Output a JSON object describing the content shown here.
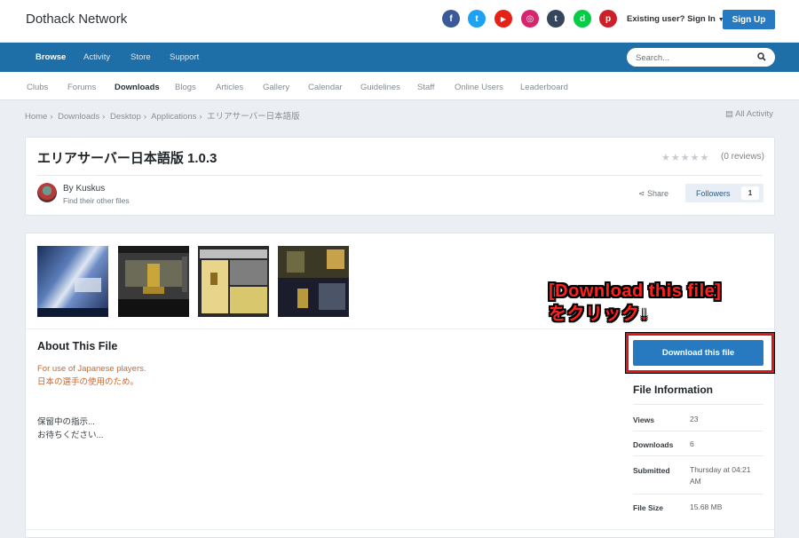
{
  "header": {
    "site_title": "Dothack Network",
    "signin": "Existing user? Sign In",
    "signup": "Sign Up",
    "social": [
      {
        "name": "facebook",
        "color": "#3b5998",
        "glyph": "f"
      },
      {
        "name": "twitter",
        "color": "#1da1f2",
        "glyph": "t"
      },
      {
        "name": "youtube",
        "color": "#e62117",
        "glyph": "▶"
      },
      {
        "name": "instagram",
        "color": "#d6246e",
        "glyph": "◎"
      },
      {
        "name": "tumblr",
        "color": "#35465c",
        "glyph": "t"
      },
      {
        "name": "deviantart",
        "color": "#05cc47",
        "glyph": "d"
      },
      {
        "name": "pinterest",
        "color": "#cb2027",
        "glyph": "p"
      }
    ]
  },
  "nav": {
    "items": [
      "Browse",
      "Activity",
      "Store",
      "Support"
    ],
    "search_placeholder": "Search..."
  },
  "subnav": {
    "items": [
      "Clubs",
      "Forums",
      "Downloads",
      "Blogs",
      "Articles",
      "Gallery",
      "Calendar",
      "Guidelines",
      "Staff",
      "Online Users",
      "Leaderboard"
    ]
  },
  "breadcrumb": {
    "items": [
      "Home",
      "Downloads",
      "Desktop",
      "Applications",
      "エリアサーバー日本語版"
    ],
    "all_activity": "All Activity"
  },
  "file": {
    "title": "エリアサーバー日本語版 1.0.3",
    "reviews": "(0 reviews)",
    "author": "By Kuskus",
    "author_link": "Find their other files",
    "share": "Share",
    "followers_label": "Followers",
    "followers_count": "1"
  },
  "about": {
    "heading": "About This File",
    "desc_en": "For use of Japanese players.",
    "desc_jp": "日本の選手の使用のため。",
    "pending_1": "保留中の指示...",
    "pending_2": "お待ちください..."
  },
  "annotation": {
    "line1": "[Download this file]",
    "line2": "をクリック↓"
  },
  "download_button": "Download this file",
  "file_info": {
    "heading": "File Information",
    "rows": [
      {
        "key": "Views",
        "value": "23"
      },
      {
        "key": "Downloads",
        "value": "6"
      },
      {
        "key": "Submitted",
        "value": "Thursday at 04:21 AM"
      },
      {
        "key": "File Size",
        "value": "15.68 MB"
      }
    ]
  }
}
